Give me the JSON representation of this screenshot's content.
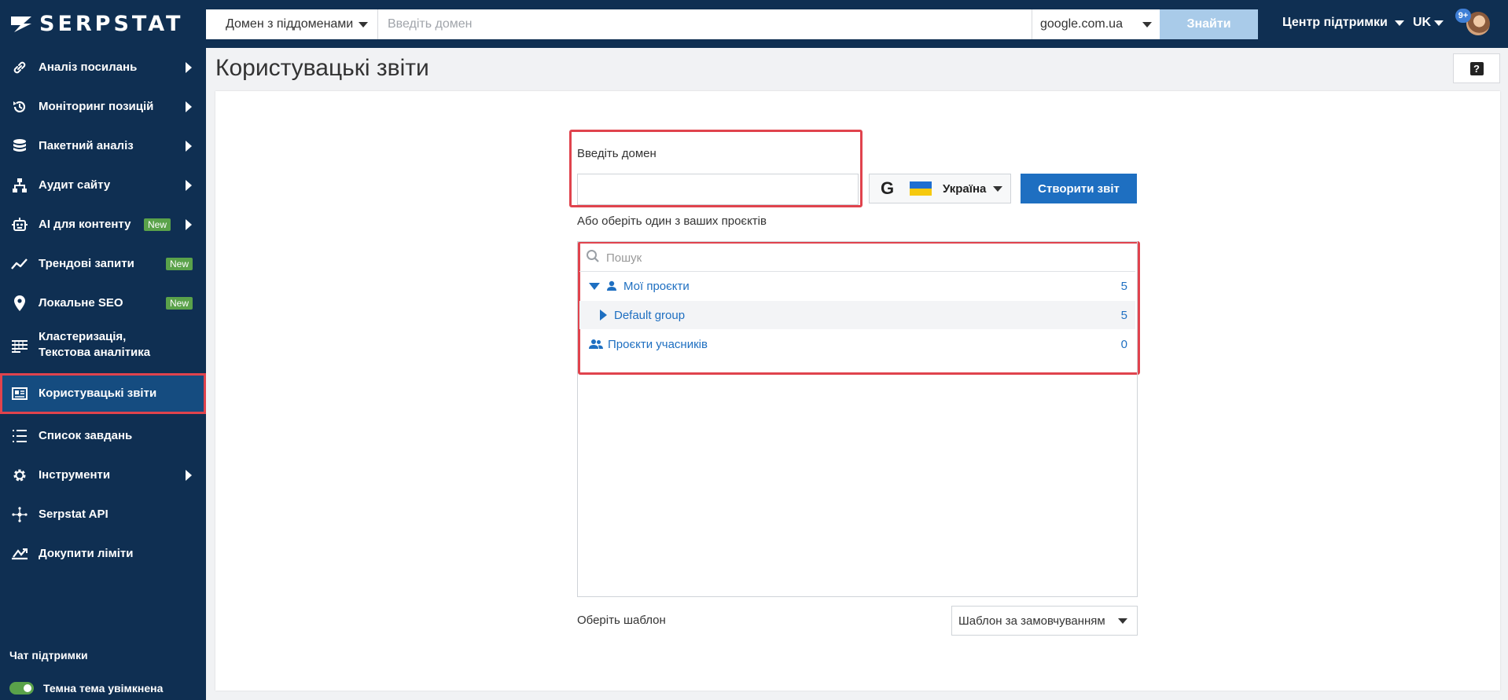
{
  "header": {
    "logo_text": "SERPSTAT",
    "scope_select": "Домен з піддоменами",
    "search_placeholder": "Введіть домен",
    "search_engine": "google.com.ua",
    "find_button": "Знайти",
    "support_link": "Центр підтримки",
    "language": "UK",
    "notifications_badge": "9+"
  },
  "sidebar": {
    "items": [
      {
        "label": "Аналіз посилань",
        "icon": "link-icon",
        "has_arrow": true
      },
      {
        "label": "Моніторинг позицій",
        "icon": "history-icon",
        "has_arrow": true
      },
      {
        "label": "Пакетний аналіз",
        "icon": "database-icon",
        "has_arrow": true
      },
      {
        "label": "Аудит сайту",
        "icon": "sitemap-icon",
        "has_arrow": true
      },
      {
        "label": "AI для контенту",
        "icon": "robot-icon",
        "has_arrow": true,
        "badge": "New"
      },
      {
        "label": "Трендові запити",
        "icon": "trend-icon",
        "badge": "New"
      },
      {
        "label": "Локальне SEO",
        "icon": "map-pin-icon",
        "badge": "New"
      },
      {
        "label": "Кластеризація,",
        "label_line2": "Текстова аналітика",
        "icon": "clustering-icon"
      },
      {
        "label": "Користувацькі звіти",
        "icon": "report-icon",
        "active": true
      },
      {
        "label": "Список завдань",
        "icon": "list-icon"
      },
      {
        "label": "Інструменти",
        "icon": "gear-icon",
        "has_arrow": true
      },
      {
        "label": "Serpstat API",
        "icon": "api-icon"
      },
      {
        "label": "Докупити ліміти",
        "icon": "limits-icon"
      }
    ],
    "chat_title": "Чат підтримки",
    "theme_toggle": "Темна тема увімкнена"
  },
  "main": {
    "page_title": "Користувацькі звіти",
    "help_button": "?",
    "domain_label": "Введіть домен",
    "domain_value": "",
    "region": "Україна",
    "create_button": "Створити звіт",
    "or_pick_label": "Або оберіть один з ваших проєктів",
    "tree_search_placeholder": "Пошук",
    "tree": {
      "my_projects": {
        "label": "Мої проєкти",
        "count": "5"
      },
      "default_group": {
        "label": "Default group",
        "count": "5"
      },
      "member_projects": {
        "label": "Проєкти учасників",
        "count": "0"
      }
    },
    "template_label": "Оберіть шаблон",
    "template_select": "Шаблон за замовчуванням"
  },
  "colors": {
    "sidebar_bg": "#0f2f52",
    "accent": "#1e6fc1",
    "highlight": "#e0434d",
    "badge_new": "#5aa24a"
  }
}
